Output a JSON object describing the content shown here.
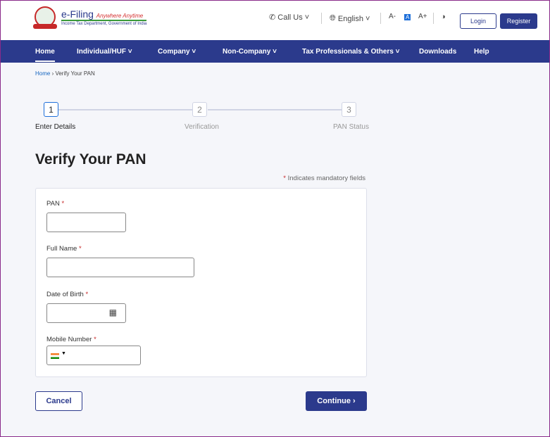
{
  "header": {
    "logo_title": "e-Filing",
    "logo_tagline": "Anywhere Anytime",
    "logo_subtitle": "Income Tax Department, Government of India",
    "call_us": "Call Us",
    "language": "English",
    "font_decrease": "A-",
    "font_normal": "A",
    "font_increase": "A+",
    "login": "Login",
    "register": "Register"
  },
  "nav": {
    "items": [
      "Home",
      "Individual/HUF ˅",
      "Company ˅",
      "Non-Company ˅",
      "Tax Professionals & Others ˅",
      "Downloads",
      "Help"
    ]
  },
  "breadcrumb": {
    "home": "Home",
    "current": "Verify Your PAN"
  },
  "stepper": {
    "steps": [
      {
        "num": "1",
        "label": "Enter Details"
      },
      {
        "num": "2",
        "label": "Verification"
      },
      {
        "num": "3",
        "label": "PAN Status"
      }
    ]
  },
  "page": {
    "title": "Verify Your PAN",
    "mandatory_note": "Indicates mandatory fields",
    "asterisk": "*"
  },
  "form": {
    "pan_label": "PAN",
    "pan_value": "",
    "name_label": "Full Name",
    "name_value": "",
    "dob_label": "Date of Birth",
    "dob_value": "",
    "mobile_label": "Mobile Number",
    "mobile_value": ""
  },
  "actions": {
    "cancel": "Cancel",
    "continue": "Continue ›"
  }
}
